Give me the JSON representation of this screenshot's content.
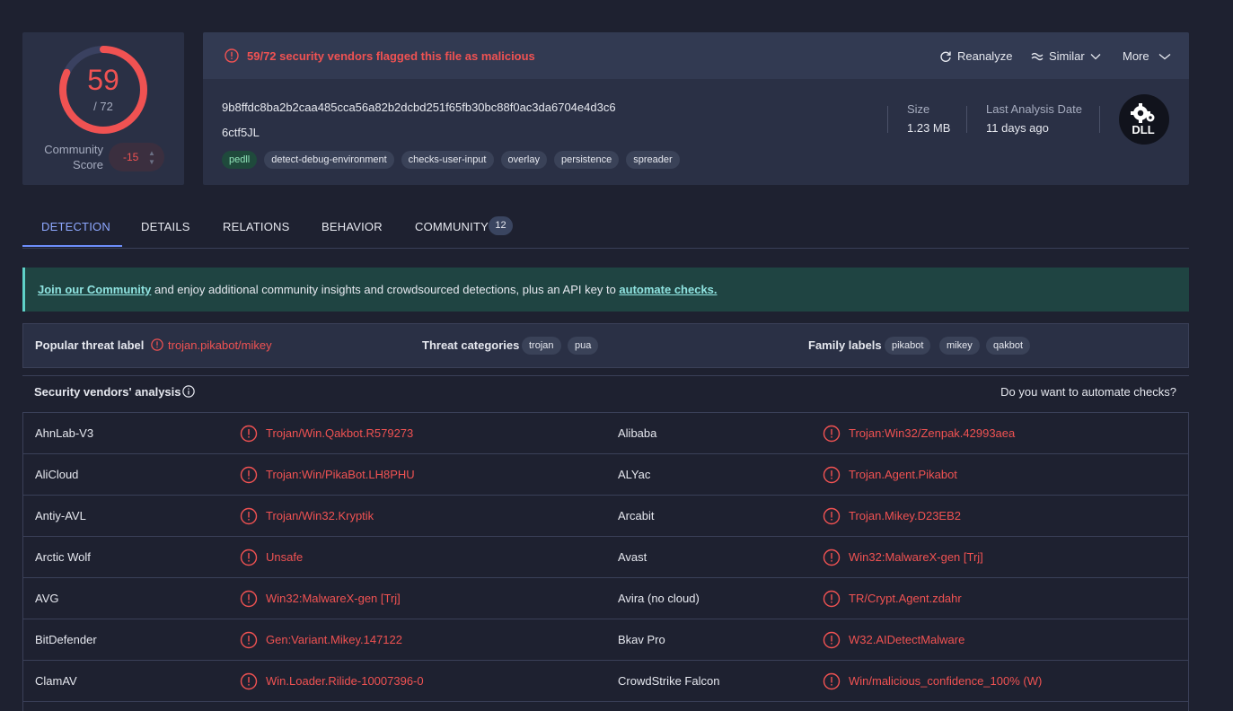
{
  "score": {
    "detections": "59",
    "total": "/ 72",
    "ratio": 0.819,
    "community_label": "Community Score",
    "community_value": "-15"
  },
  "header": {
    "alert": "59/72 security vendors flagged this file as malicious",
    "reanalyze": "Reanalyze",
    "similar": "Similar",
    "more": "More"
  },
  "file": {
    "hash": "9b8ffdc8ba2b2caa485cca56a82b2dcbd251f65fb30bc88f0ac3da6704e4d3c6",
    "name": "6ctf5JL",
    "tags": [
      "pedll",
      "detect-debug-environment",
      "checks-user-input",
      "overlay",
      "persistence",
      "spreader"
    ],
    "size_label": "Size",
    "size_value": "1.23 MB",
    "last_analysis_label": "Last Analysis Date",
    "last_analysis_value": "11 days ago",
    "type_icon_text": "DLL"
  },
  "tabs": [
    {
      "label": "DETECTION"
    },
    {
      "label": "DETAILS"
    },
    {
      "label": "RELATIONS"
    },
    {
      "label": "BEHAVIOR"
    },
    {
      "label": "COMMUNITY",
      "count": "12"
    }
  ],
  "banner": {
    "link1": "Join our Community",
    "middle": " and enjoy additional community insights and crowdsourced detections, plus an API key to ",
    "link2": "automate checks."
  },
  "threat": {
    "popular_label": "Popular threat label",
    "popular_value": "trojan.pikabot/mikey",
    "categories_label": "Threat categories",
    "categories": [
      "trojan",
      "pua"
    ],
    "family_label": "Family labels",
    "families": [
      "pikabot",
      "mikey",
      "qakbot"
    ]
  },
  "vendors": {
    "title": "Security vendors' analysis",
    "automate_question": "Do you want to automate checks?",
    "rows": [
      {
        "left_name": "AhnLab-V3",
        "left_result": "Trojan/Win.Qakbot.R579273",
        "right_name": "Alibaba",
        "right_result": "Trojan:Win32/Zenpak.42993aea"
      },
      {
        "left_name": "AliCloud",
        "left_result": "Trojan:Win/PikaBot.LH8PHU",
        "right_name": "ALYac",
        "right_result": "Trojan.Agent.Pikabot"
      },
      {
        "left_name": "Antiy-AVL",
        "left_result": "Trojan/Win32.Kryptik",
        "right_name": "Arcabit",
        "right_result": "Trojan.Mikey.D23EB2"
      },
      {
        "left_name": "Arctic Wolf",
        "left_result": "Unsafe",
        "right_name": "Avast",
        "right_result": "Win32:MalwareX-gen [Trj]"
      },
      {
        "left_name": "AVG",
        "left_result": "Win32:MalwareX-gen [Trj]",
        "right_name": "Avira (no cloud)",
        "right_result": "TR/Crypt.Agent.zdahr"
      },
      {
        "left_name": "BitDefender",
        "left_result": "Gen:Variant.Mikey.147122",
        "right_name": "Bkav Pro",
        "right_result": "W32.AIDetectMalware"
      },
      {
        "left_name": "ClamAV",
        "left_result": "Win.Loader.Rilide-10007396-0",
        "right_name": "CrowdStrike Falcon",
        "right_result": "Win/malicious_confidence_100% (W)"
      }
    ]
  },
  "colors": {
    "malicious": "#f05252",
    "accent": "#6e8efb",
    "background": "#1e2130",
    "card": "#2a3045"
  },
  "icons": [
    "alert-circle-icon",
    "refresh-icon",
    "similar-icon",
    "chevron-down-icon",
    "info-icon",
    "dll-gear-icon"
  ]
}
